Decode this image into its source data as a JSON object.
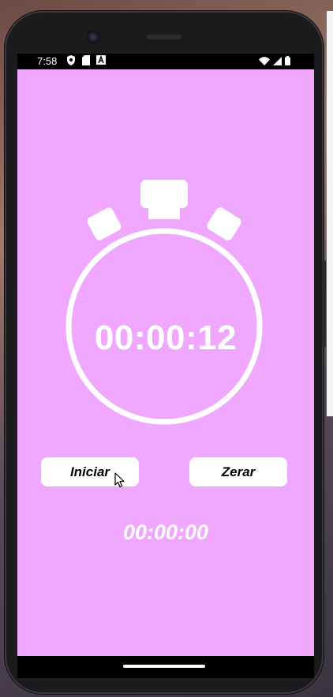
{
  "status_bar": {
    "time": "7:58",
    "left_icons": [
      "shield-icon",
      "sim-card-icon",
      "text-a-icon"
    ],
    "right_icons": [
      "wifi-icon",
      "signal-icon",
      "battery-icon"
    ]
  },
  "app": {
    "background_color": "#f0a8fe",
    "timer_value": "00:00:12",
    "buttons": {
      "start_label": "Iniciar",
      "reset_label": "Zerar"
    },
    "lap_value": "00:00:00"
  }
}
